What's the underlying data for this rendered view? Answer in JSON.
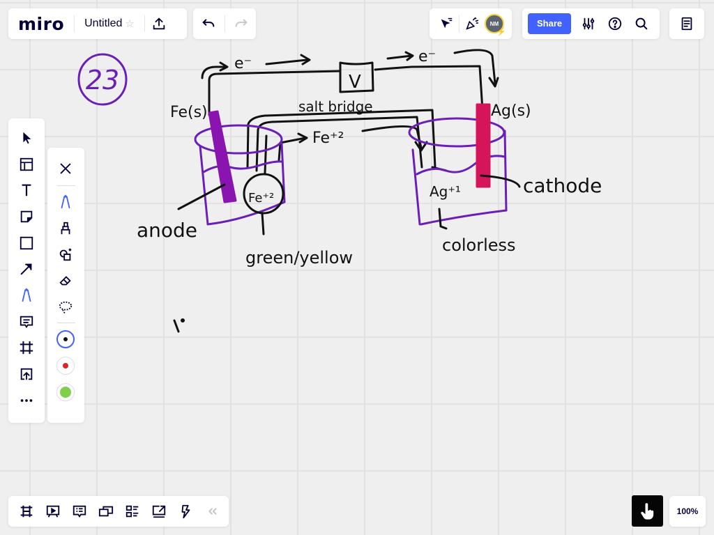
{
  "app": {
    "logo": "miro",
    "board_title": "Untitled"
  },
  "top_left_toolbar": {
    "favorite_icon": "star-icon",
    "export_icon": "upload-icon",
    "undo_icon": "undo-icon",
    "redo_icon": "redo-icon"
  },
  "top_right_toolbar": {
    "cursor_icon": "cursor-tracking-icon",
    "reaction_icon": "party-popper-icon",
    "avatar_initials": "NM",
    "share_label": "Share",
    "settings_icon": "sliders-icon",
    "help_icon": "help-icon",
    "search_icon": "search-icon",
    "notes_icon": "notes-icon"
  },
  "left_toolbar": {
    "tools": [
      {
        "name": "select",
        "icon": "cursor-arrow-icon"
      },
      {
        "name": "templates",
        "icon": "templates-icon"
      },
      {
        "name": "text",
        "icon": "text-icon"
      },
      {
        "name": "sticky-note",
        "icon": "sticky-note-icon"
      },
      {
        "name": "shape",
        "icon": "rectangle-icon"
      },
      {
        "name": "connection-line",
        "icon": "arrow-icon"
      },
      {
        "name": "pen",
        "icon": "pen-icon",
        "active": true
      },
      {
        "name": "comment",
        "icon": "comment-icon"
      },
      {
        "name": "frame",
        "icon": "frame-icon"
      },
      {
        "name": "upload",
        "icon": "upload-icon"
      },
      {
        "name": "more",
        "icon": "more-icon"
      }
    ],
    "active_color": "#4262ff"
  },
  "pen_panel": {
    "close_icon": "close-icon",
    "tools": [
      {
        "name": "pen",
        "icon": "pen-icon",
        "active": true
      },
      {
        "name": "highlighter",
        "icon": "highlighter-icon"
      },
      {
        "name": "smart-drawing",
        "icon": "shapes-sparkle-icon"
      },
      {
        "name": "eraser",
        "icon": "eraser-icon"
      },
      {
        "name": "lasso",
        "icon": "lasso-icon"
      }
    ],
    "colors": [
      {
        "name": "black",
        "hex": "#111111",
        "selected": true
      },
      {
        "name": "red",
        "hex": "#e02424",
        "selected": false
      },
      {
        "name": "green",
        "hex": "#7ed04b",
        "selected": false
      }
    ]
  },
  "bottom_toolbar": {
    "tools": [
      {
        "name": "frames",
        "icon": "frames-icon"
      },
      {
        "name": "presentation",
        "icon": "presentation-icon"
      },
      {
        "name": "comments",
        "icon": "comments-icon"
      },
      {
        "name": "video-chat",
        "icon": "video-chat-icon"
      },
      {
        "name": "cards",
        "icon": "cards-icon"
      },
      {
        "name": "screen-share",
        "icon": "screen-share-icon"
      },
      {
        "name": "activity",
        "icon": "lightning-icon"
      },
      {
        "name": "collapse",
        "icon": "double-chevron-left-icon"
      }
    ]
  },
  "bottom_right": {
    "hand_tool_icon": "hand-pointer-icon",
    "zoom_level": "100%"
  },
  "drawing": {
    "problem_number": "23",
    "labels": {
      "electron_left": "e⁻",
      "electron_right": "e⁻",
      "voltmeter": "V",
      "anode_metal": "Fe(s)",
      "cathode_metal": "Ag(s)",
      "salt_bridge": "salt bridge",
      "fe_ion_flow": "Fe⁺²",
      "fe_ion_circle": "Fe⁺²",
      "ag_ion": "Ag⁺¹",
      "anode": "anode",
      "cathode": "cathode",
      "anode_solution_color": "green/yellow",
      "cathode_solution_color": "colorless",
      "stray_mark": "\\'"
    },
    "colors": {
      "ink": "#111111",
      "beaker": "#6a1fb5",
      "fe_electrode": "#8a14b0",
      "ag_electrode": "#d6145a",
      "circle_number": "#6a1fb5"
    }
  }
}
